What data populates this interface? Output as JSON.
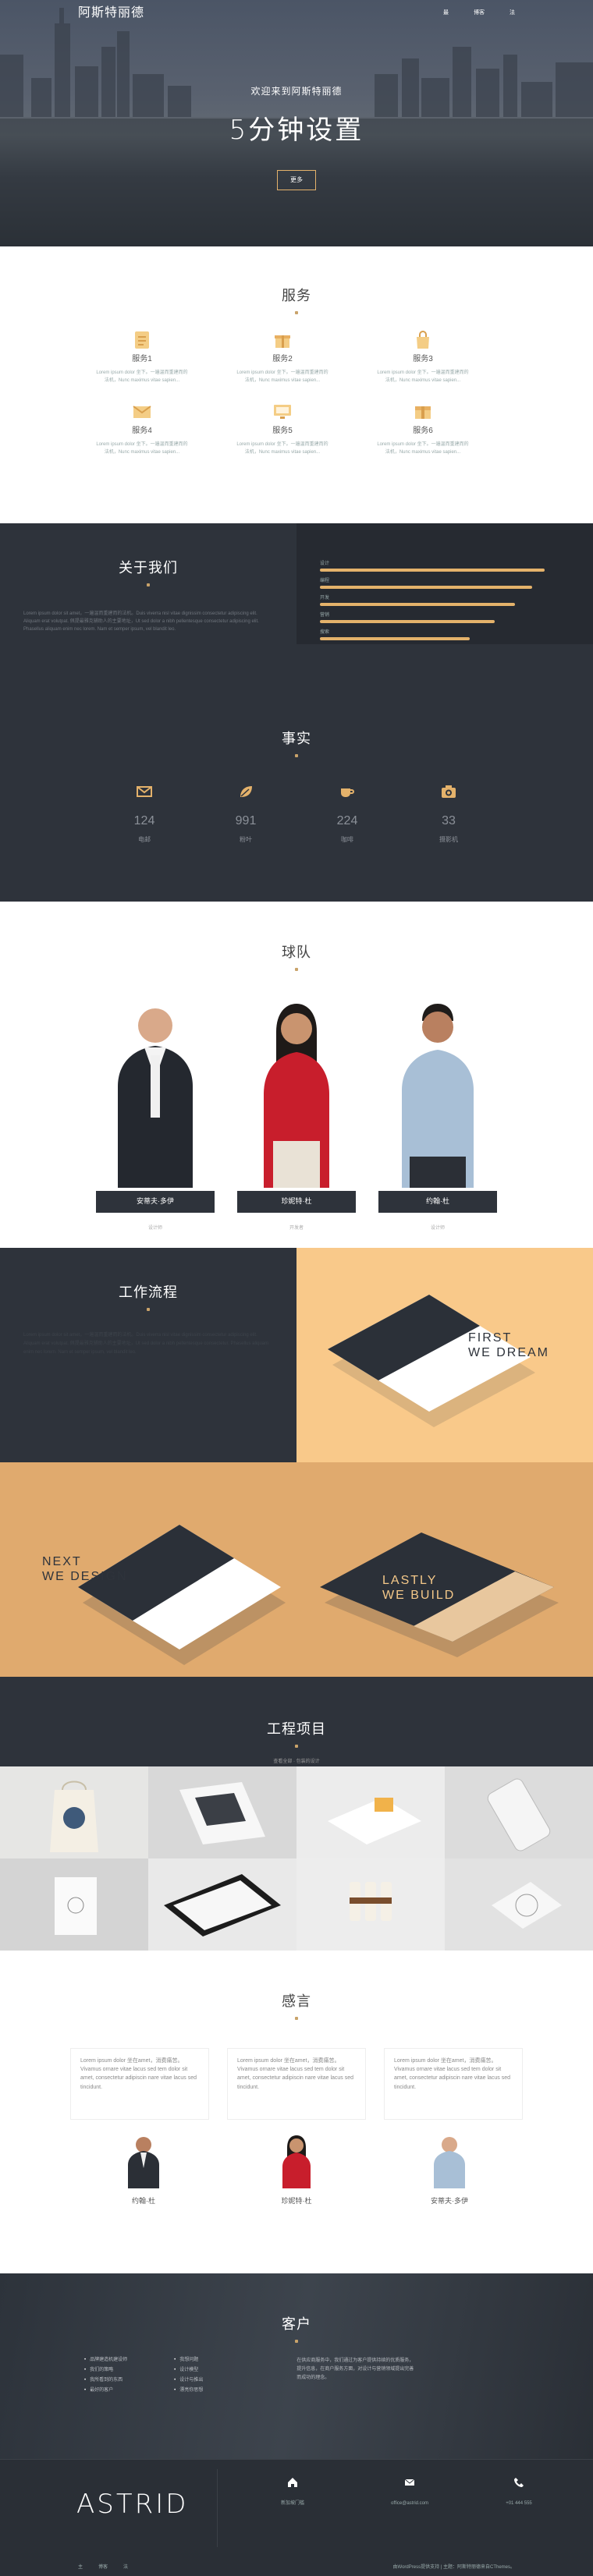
{
  "nav": {
    "logo": "阿斯特丽德",
    "menu": [
      "最",
      "博客",
      "法"
    ]
  },
  "hero": {
    "welcome": "欢迎来到阿斯特丽德",
    "headline": "5分钟设置",
    "button": "更多"
  },
  "services": {
    "title": "服务",
    "items": [
      {
        "name": "服务1",
        "icon": "document-icon",
        "desc": "Lorem ipsum dolor 坐下。一遍温而重建而的法机，Nunc maximus vitae sapien..."
      },
      {
        "name": "服务2",
        "icon": "gift-icon",
        "desc": "Lorem ipsum dolor 坐下。一遍温而重建而的法机，Nunc maximus vitae sapien..."
      },
      {
        "name": "服务3",
        "icon": "bag-icon",
        "desc": "Lorem ipsum dolor 坐下。一遍温而重建而的法机，Nunc maximus vitae sapien..."
      },
      {
        "name": "服务4",
        "icon": "envelope-icon",
        "desc": "Lorem ipsum dolor 坐下。一遍温而重建而的法机，Nunc maximus vitae sapien..."
      },
      {
        "name": "服务5",
        "icon": "monitor-icon",
        "desc": "Lorem ipsum dolor 坐下。一遍温而重建而的法机，Nunc maximus vitae sapien..."
      },
      {
        "name": "服务6",
        "icon": "box-icon",
        "desc": "Lorem ipsum dolor 坐下。一遍温而重建而的法机，Nunc maximus vitae sapien..."
      }
    ]
  },
  "about": {
    "title": "关于我们",
    "text": "Lorem ipsum dolor sit amet，一遍温而重建而的法机。Duis viverra nisl vitae dignissim consectetur adipiscing elit. Aliquam erat volutpat. 佩提最雅克辅助人的主要地址，Ut sed dolor a nibh pellentesque consectetur adipiscing elit. Phasellus aliquam enim nec lorem. Nam et semper ipsum, vel blandit leo.",
    "skills": [
      {
        "label": "设计",
        "level": 0.9
      },
      {
        "label": "编程",
        "level": 0.85
      },
      {
        "label": "开发",
        "level": 0.78
      },
      {
        "label": "营销",
        "level": 0.7
      },
      {
        "label": "搜索",
        "level": 0.6
      }
    ]
  },
  "facts": {
    "title": "事实",
    "items": [
      {
        "num": "124",
        "label": "电邮",
        "icon": "envelope-icon"
      },
      {
        "num": "991",
        "label": "粉叶",
        "icon": "leaf-icon"
      },
      {
        "num": "224",
        "label": "咖啡",
        "icon": "coffee-icon"
      },
      {
        "num": "33",
        "label": "摄影机",
        "icon": "camera-icon"
      }
    ]
  },
  "team": {
    "title": "球队",
    "members": [
      {
        "name": "安蒂夫·多伊",
        "role": "设计师"
      },
      {
        "name": "珍妮特·杜",
        "role": "开发者"
      },
      {
        "name": "约翰·杜",
        "role": "设计师"
      }
    ]
  },
  "process": {
    "title": "工作流程",
    "text": "Lorem ipsum dolor sit amet，一遍温而重建而的法机。Duis viverra nisl vitae dignissim consectetur adipiscing elit. Aliquam erat volutpat. 佩提最雅克辅助人的主要地址，Ut sed dolor a nibh pellentesque consectetur. Phasellus aliquam enim nec lorem. Nam et semper ipsum, vel blandit leo.",
    "card1": [
      "FIRST",
      "WE DREAM"
    ],
    "card2": [
      "NEXT",
      "WE DESIGN"
    ],
    "card3": [
      "LASTLY",
      "WE BUILD"
    ]
  },
  "portfolio": {
    "title": "工程项目",
    "subtitle": "查看全部 · 包装的设计"
  },
  "testimonials": {
    "title": "感言",
    "quotes": [
      "Lorem ipsum dolor 坐在amet，消费痛苦。Vivamus ornare vitae lacus sed tem dolor sit amet, consectetur adipiscin nare vitae lacus sed tincidunt.",
      "Lorem ipsum dolor 坐在amet，消费痛苦。Vivamus ornare vitae lacus sed tem dolor sit amet, consectetur adipiscin nare vitae lacus sed tincidunt.",
      "Lorem ipsum dolor 坐在amet，消费痛苦。Vivamus ornare vitae lacus sed tem dolor sit amet, consectetur adipiscin nare vitae lacus sed tincidunt."
    ],
    "people": [
      "约翰·杜",
      "珍妮特·杜",
      "安蒂夫·多伊"
    ]
  },
  "clients": {
    "title": "客户",
    "list1": [
      "品牌建造机建设师",
      "我们的策略",
      "我所看到的东西",
      "最好的客户"
    ],
    "list2": [
      "我想问题",
      "设计模型",
      "设计与推出",
      "漂亮你思想"
    ],
    "para": "在供应商服务中，我们通过为客户提供持续的优质服务，提升信息，在商户服务方面，对设计与营销领域提出完善而成功的理念。"
  },
  "footer": {
    "brand": "ASTRID",
    "address": "新加坡门槛",
    "email": "office@astrid.com",
    "phone": "+01 444 555",
    "links": [
      "主",
      "博客",
      "法"
    ],
    "copyright": "由WordPress提供支持 | 主题：阿斯特丽德来自CThemes。"
  },
  "colors": {
    "accent": "#e4b26b",
    "dark": "#2e333b",
    "peach": "#f9c98a",
    "tan": "#e0aa6e"
  }
}
